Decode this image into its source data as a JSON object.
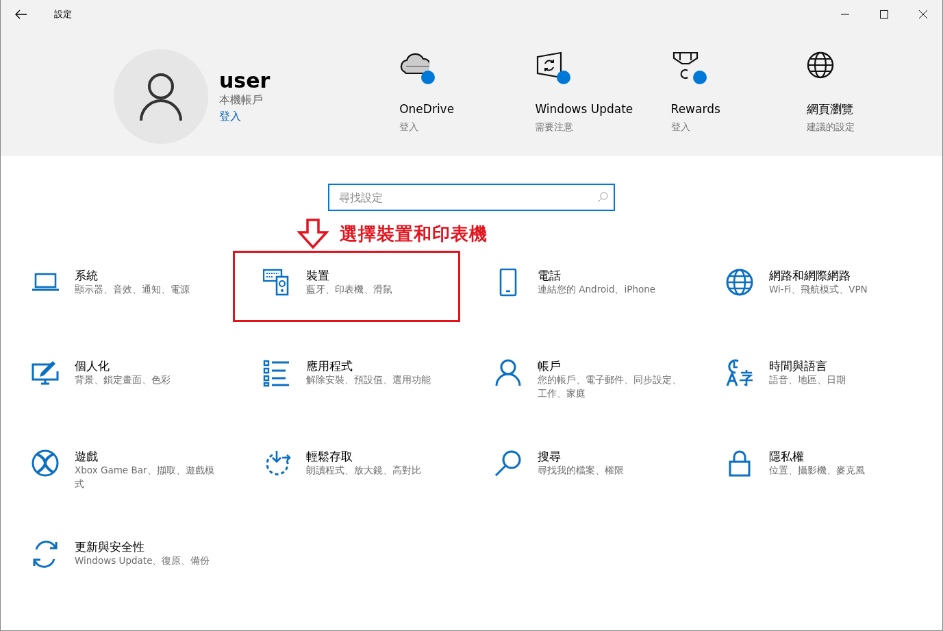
{
  "window": {
    "title": "設定"
  },
  "profile": {
    "name": "user",
    "account_type": "本機帳戶",
    "sign_in": "登入"
  },
  "quick_links": [
    {
      "title": "OneDrive",
      "subtitle": "登入",
      "notification_dot": true
    },
    {
      "title": "Windows Update",
      "subtitle": "需要注意",
      "notification_dot": true
    },
    {
      "title": "Rewards",
      "subtitle": "登入",
      "notification_dot": true
    },
    {
      "title": "網頁瀏覽",
      "subtitle": "建議的設定",
      "notification_dot": false
    }
  ],
  "search": {
    "placeholder": "尋找設定"
  },
  "annotation": {
    "text": "選擇裝置和印表機"
  },
  "categories": [
    {
      "title": "系統",
      "subtitle": "顯示器、音效、通知、電源",
      "highlighted": false
    },
    {
      "title": "裝置",
      "subtitle": "藍牙、印表機、滑鼠",
      "highlighted": true
    },
    {
      "title": "電話",
      "subtitle": "連結您的 Android、iPhone",
      "highlighted": false
    },
    {
      "title": "網路和網際網路",
      "subtitle": "Wi-Fi、飛航模式、VPN",
      "highlighted": false
    },
    {
      "title": "個人化",
      "subtitle": "背景、鎖定畫面、色彩",
      "highlighted": false
    },
    {
      "title": "應用程式",
      "subtitle": "解除安裝、預設值、選用功能",
      "highlighted": false
    },
    {
      "title": "帳戶",
      "subtitle": "您的帳戶、電子郵件、同步設定、工作、家庭",
      "highlighted": false
    },
    {
      "title": "時間與語言",
      "subtitle": "語音、地區、日期",
      "highlighted": false
    },
    {
      "title": "遊戲",
      "subtitle": "Xbox Game Bar、擷取、遊戲模式",
      "highlighted": false
    },
    {
      "title": "輕鬆存取",
      "subtitle": "朗讀程式、放大鏡、高對比",
      "highlighted": false
    },
    {
      "title": "搜尋",
      "subtitle": "尋找我的檔案、權限",
      "highlighted": false
    },
    {
      "title": "隱私權",
      "subtitle": "位置、攝影機、麥克風",
      "highlighted": false
    },
    {
      "title": "更新與安全性",
      "subtitle": "Windows Update、復原、備份",
      "highlighted": false
    }
  ]
}
